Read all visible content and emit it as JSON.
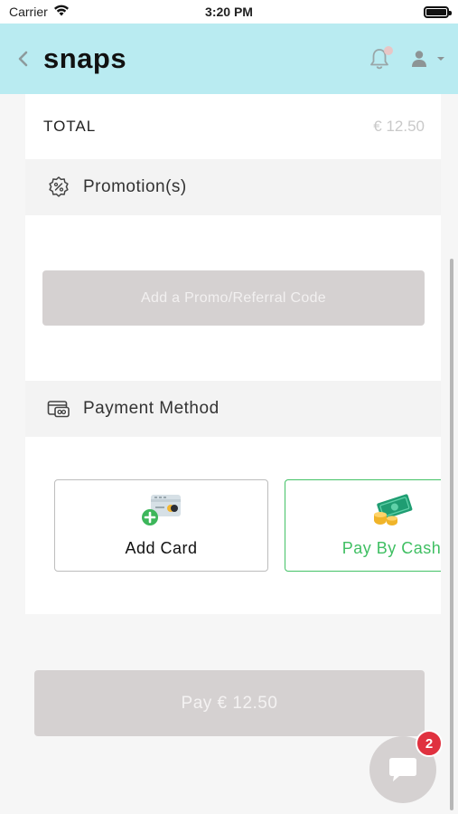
{
  "status_bar": {
    "carrier": "Carrier",
    "time": "3:20 PM"
  },
  "header": {
    "title": "snaps",
    "notification_dot_color": "#e8c6c6",
    "background": "#b9ebf1"
  },
  "order": {
    "total_label": "TOTAL",
    "total_value": "€ 12.50"
  },
  "promotions": {
    "title": "Promotion(s)",
    "button_label": "Add a Promo/Referral Code"
  },
  "payment": {
    "title": "Payment Method",
    "options": [
      {
        "label": "Add Card",
        "icon": "add-card-icon",
        "selected": false
      },
      {
        "label": "Pay By Cash",
        "icon": "cash-icon",
        "selected": true
      }
    ],
    "accent_color": "#3fbf62"
  },
  "pay_button": {
    "label": "Pay € 12.50"
  },
  "chat": {
    "badge_count": "2"
  }
}
